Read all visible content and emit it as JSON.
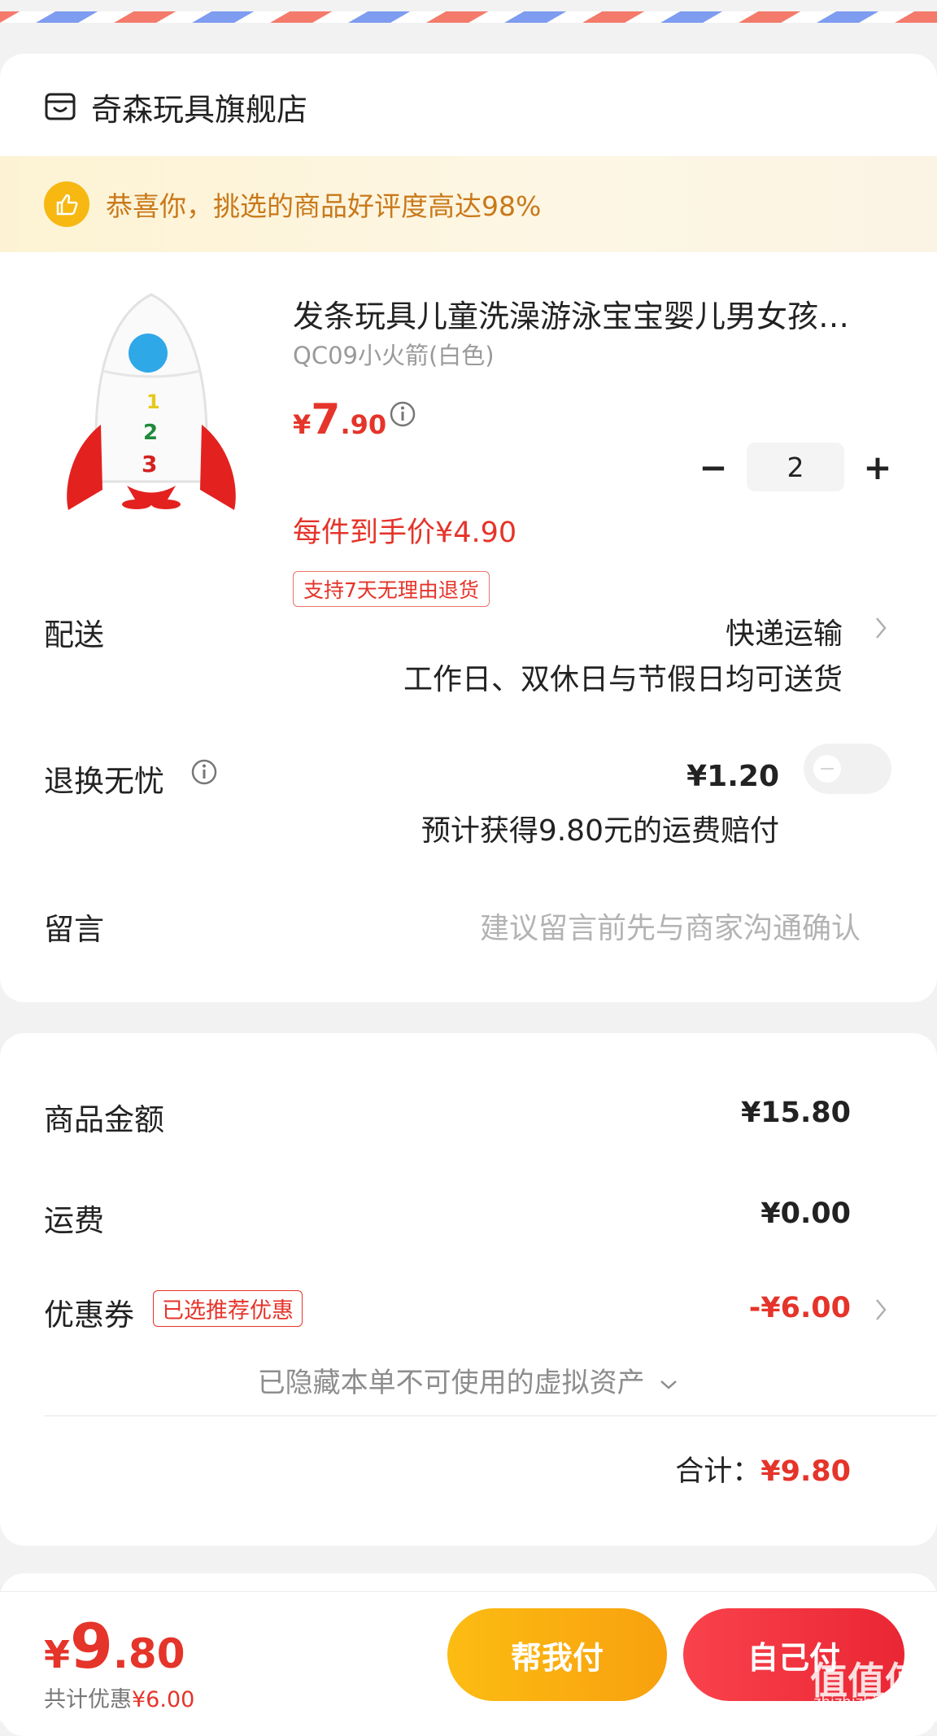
{
  "store": {
    "name": "奇森玩具旗舰店"
  },
  "banner": {
    "text": "恭喜你，挑选的商品好评度高达98%"
  },
  "product": {
    "title": "发条玩具儿童洗澡游泳宝宝婴儿男女孩…",
    "spec": "QC09小火箭(白色)",
    "price_yen": "¥",
    "price_int": "7",
    "price_dec": ".90",
    "deal_price": "每件到手价¥4.90",
    "return_tag": "支持7天无理由退货",
    "quantity": "2",
    "minus": "−",
    "plus": "+"
  },
  "delivery": {
    "label": "配送",
    "method": "快递运输",
    "note": "工作日、双休日与节假日均可送货"
  },
  "return_insurance": {
    "label": "退换无忧",
    "price": "¥1.20",
    "note": "预计获得9.80元的运费赔付",
    "enabled": false
  },
  "message": {
    "label": "留言",
    "placeholder": "建议留言前先与商家沟通确认"
  },
  "summary": {
    "goods_label": "商品金额",
    "goods_value": "¥15.80",
    "shipping_label": "运费",
    "shipping_value": "¥0.00",
    "coupon_label": "优惠券",
    "coupon_tag": "已选推荐优惠",
    "coupon_value": "-¥6.00",
    "hidden_assets": "已隐藏本单不可使用的虚拟资产",
    "total_label": "合计：",
    "total_value": "¥9.80"
  },
  "bottom": {
    "price_yen": "¥",
    "price_int": "9",
    "price_dec": ".80",
    "save_label": "共计优惠",
    "save_amount": "¥6.00",
    "help_pay": "帮我付",
    "self_pay": "自己付"
  },
  "watermark": {
    "main": "值值值",
    "sub": "zhizhizhi.com"
  },
  "colors": {
    "accent_red": "#e5342a",
    "banner_text": "#c9791a",
    "help_btn": "#fcbc12",
    "self_btn": "#ea2633"
  }
}
